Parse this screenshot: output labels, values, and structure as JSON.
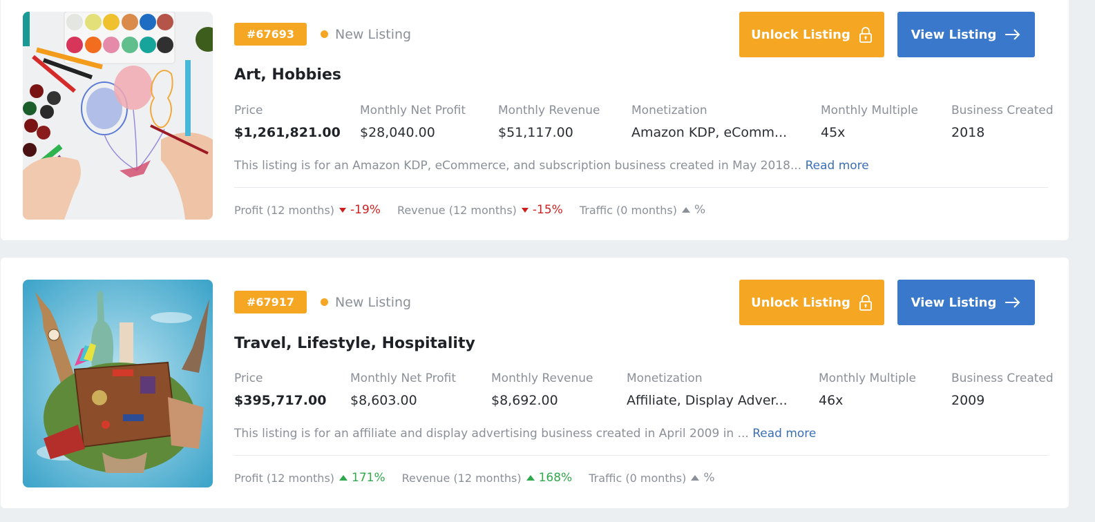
{
  "listings": [
    {
      "id_badge": "#67693",
      "status": "New Listing",
      "title": "Art, Hobbies",
      "unlock_label": "Unlock Listing",
      "view_label": "View Listing",
      "metrics": [
        {
          "label": "Price",
          "value": "$1,261,821.00"
        },
        {
          "label": "Monthly Net Profit",
          "value": "$28,040.00"
        },
        {
          "label": "Monthly Revenue",
          "value": "$51,117.00"
        },
        {
          "label": "Monetization",
          "value": "Amazon KDP, eComm..."
        },
        {
          "label": "Monthly Multiple",
          "value": "45x"
        },
        {
          "label": "Business Created",
          "value": "2018"
        }
      ],
      "description": "This listing is for an Amazon KDP, eCommerce, and subscription business created in May 2018...",
      "read_more": "Read more",
      "stats": [
        {
          "label": "Profit (12 months)",
          "trend": "down",
          "value": "-19%"
        },
        {
          "label": "Revenue (12 months)",
          "trend": "down",
          "value": "-15%"
        },
        {
          "label": "Traffic (0 months)",
          "trend": "neutral",
          "value": "%"
        }
      ],
      "image_alt": "Watercolor paints, markers and hands drawing balloons"
    },
    {
      "id_badge": "#67917",
      "status": "New Listing",
      "title": "Travel, Lifestyle, Hospitality",
      "unlock_label": "Unlock Listing",
      "view_label": "View Listing",
      "metrics": [
        {
          "label": "Price",
          "value": "$395,717.00"
        },
        {
          "label": "Monthly Net Profit",
          "value": "$8,603.00"
        },
        {
          "label": "Monthly Revenue",
          "value": "$8,692.00"
        },
        {
          "label": "Monetization",
          "value": "Affiliate, Display Adver..."
        },
        {
          "label": "Monthly Multiple",
          "value": "46x"
        },
        {
          "label": "Business Created",
          "value": "2009"
        }
      ],
      "description": "This listing is for an affiliate and display advertising business created in April 2009 in ...",
      "read_more": "Read more",
      "stats": [
        {
          "label": "Profit (12 months)",
          "trend": "up",
          "value": "171%"
        },
        {
          "label": "Revenue (12 months)",
          "trend": "up",
          "value": "168%"
        },
        {
          "label": "Traffic (0 months)",
          "trend": "neutral",
          "value": "%"
        }
      ],
      "image_alt": "Travel suitcase with world landmarks on a globe"
    }
  ],
  "colors": {
    "accent_orange": "#f5a623",
    "accent_blue": "#3a78cc",
    "negative": "#cc1f1f",
    "positive": "#2ea84a",
    "muted": "#8a8f98",
    "link": "#3a6fb5"
  }
}
